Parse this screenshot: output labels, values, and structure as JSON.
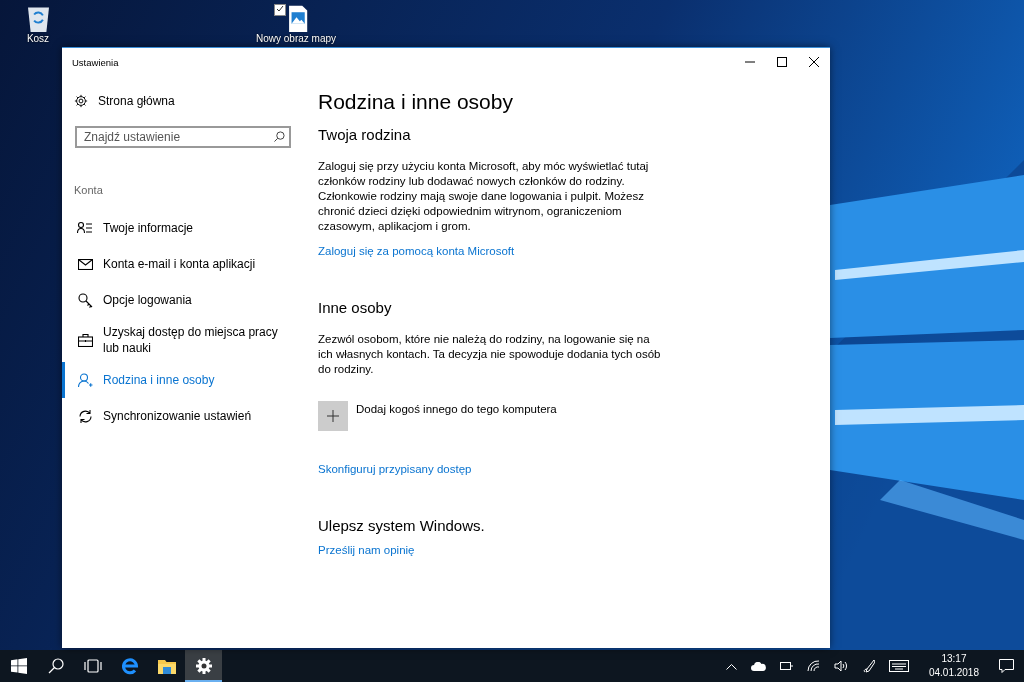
{
  "desktop": {
    "icons": [
      {
        "label": "Kosz",
        "kind": "recycle-bin"
      },
      {
        "label": "Nowy obraz mapy",
        "kind": "image-file",
        "checked": true
      }
    ]
  },
  "window": {
    "title": "Ustawienia"
  },
  "sidebar": {
    "home": "Strona główna",
    "search": {
      "placeholder": "Znajdź ustawienie"
    },
    "section": "Konta",
    "items": [
      {
        "label": "Twoje informacje",
        "kind": "info",
        "selected": false
      },
      {
        "label": "Konta e-mail i konta aplikacji",
        "kind": "email",
        "selected": false
      },
      {
        "label": "Opcje logowania",
        "kind": "sign-in",
        "selected": false
      },
      {
        "label": "Uzyskaj dostęp do miejsca pracy lub nauki",
        "kind": "work",
        "selected": false
      },
      {
        "label": "Rodzina i inne osoby",
        "kind": "family",
        "selected": true
      },
      {
        "label": "Synchronizowanie ustawień",
        "kind": "sync",
        "selected": false
      }
    ]
  },
  "content": {
    "title": "Rodzina i inne osoby",
    "sections": [
      {
        "heading": "Twoja rodzina",
        "text": "Zaloguj się przy użyciu konta Microsoft, aby móc wyświetlać tutaj członków rodziny lub dodawać nowych członków do rodziny. Członkowie rodziny mają swoje dane logowania i pulpit. Możesz chronić dzieci dzięki odpowiednim witrynom, ograniczeniom czasowym, aplikacjom i grom.",
        "links": [
          "Zaloguj się za pomocą konta Microsoft"
        ]
      },
      {
        "heading": "Inne osoby",
        "text": "Zezwól osobom, które nie należą do rodziny, na logowanie się na ich własnych kontach. Ta decyzja nie spowoduje dodania tych osób do rodziny.",
        "add_button": "Dodaj kogoś innego do tego komputera",
        "links": [
          "Skonfiguruj przypisany dostęp"
        ]
      },
      {
        "heading": "Ulepsz system Windows.",
        "links": [
          "Prześlij nam opinię"
        ]
      }
    ]
  },
  "taskbar": {
    "items": [
      {
        "kind": "start",
        "selected": false
      },
      {
        "kind": "search",
        "selected": false
      },
      {
        "kind": "task-view",
        "selected": false
      },
      {
        "kind": "browser",
        "selected": false
      },
      {
        "kind": "folder",
        "selected": false
      },
      {
        "kind": "settings",
        "selected": true
      }
    ],
    "tray": {
      "time": "13:17",
      "date": "04.01.2018"
    }
  }
}
